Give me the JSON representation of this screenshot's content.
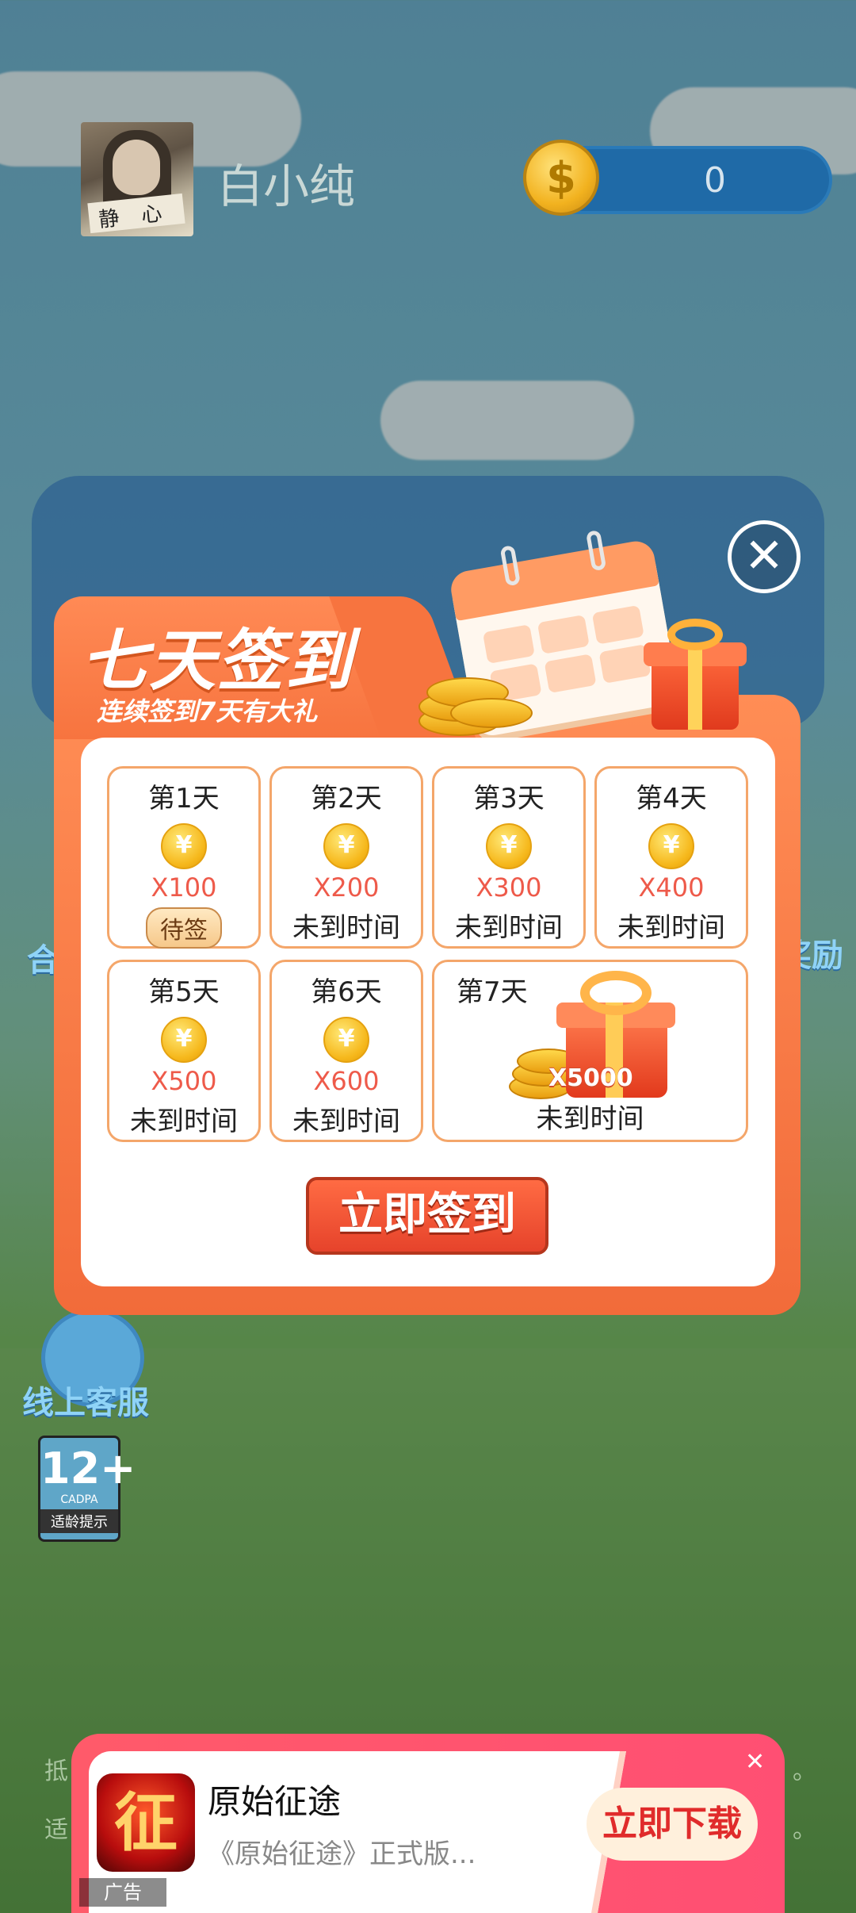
{
  "user": {
    "name": "白小纯",
    "coins": "0",
    "coin_symbol": "$",
    "avatar_text": "静心"
  },
  "background": {
    "left_label_1": "合",
    "right_label_1": "奖励",
    "customer_service": "线上客服",
    "age_rating": {
      "number": "12+",
      "org": "CADPA",
      "label": "适龄提示"
    },
    "footer_frag_1": "抵",
    "footer_frag_2": "适",
    "footer_dot_1": "。",
    "footer_dot_2": "。"
  },
  "modal": {
    "title": "七天签到",
    "subtitle": "连续签到7天有大礼",
    "close": "✕",
    "days": [
      {
        "label": "第1天",
        "amount": "X100",
        "status": "待签"
      },
      {
        "label": "第2天",
        "amount": "X200",
        "status": "未到时间"
      },
      {
        "label": "第3天",
        "amount": "X300",
        "status": "未到时间"
      },
      {
        "label": "第4天",
        "amount": "X400",
        "status": "未到时间"
      },
      {
        "label": "第5天",
        "amount": "X500",
        "status": "未到时间"
      },
      {
        "label": "第6天",
        "amount": "X600",
        "status": "未到时间"
      },
      {
        "label": "第7天",
        "amount": "X5000",
        "status": "未到时间"
      }
    ],
    "coin_symbol": "¥",
    "sign_button": "立即签到"
  },
  "ad": {
    "icon_text": "征",
    "title": "原始征途",
    "description": "《原始征途》正式版...",
    "button": "立即下载",
    "close": "✕",
    "tag": "广告"
  },
  "colors": {
    "accent": "#f26b3a",
    "amount": "#ee5a4a",
    "ad": "#ff5a6a"
  }
}
